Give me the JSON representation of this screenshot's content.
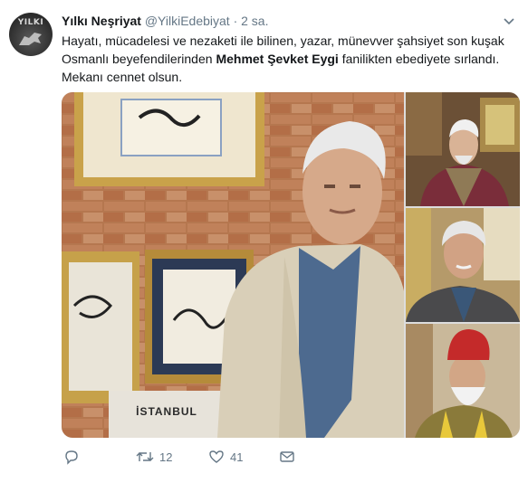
{
  "tweet": {
    "avatar_text": "YILKI",
    "display_name": "Yılkı Neşriyat",
    "handle": "@YilkiEdebiyat",
    "separator": "·",
    "time": "2 sa.",
    "text_part1": "Hayatı, mücadelesi ve nezaketi ile bilinen, yazar, münevver şahsiyet son kuşak Osmanlı beyefendilerinden ",
    "text_bold": "Mehmet Şevket Eygi",
    "text_part2": " fanilikten ebediyete sırlandı. Mekanı cennet olsun.",
    "book_label": "İSTANBUL",
    "actions": {
      "reply_count": "",
      "retweet_count": "12",
      "like_count": "41"
    }
  },
  "icons": [
    "avatar",
    "chevron-down-icon",
    "reply-icon",
    "retweet-icon",
    "heart-icon",
    "direct-message-icon"
  ],
  "colors": {
    "text": "#14171a",
    "secondary": "#657786"
  }
}
